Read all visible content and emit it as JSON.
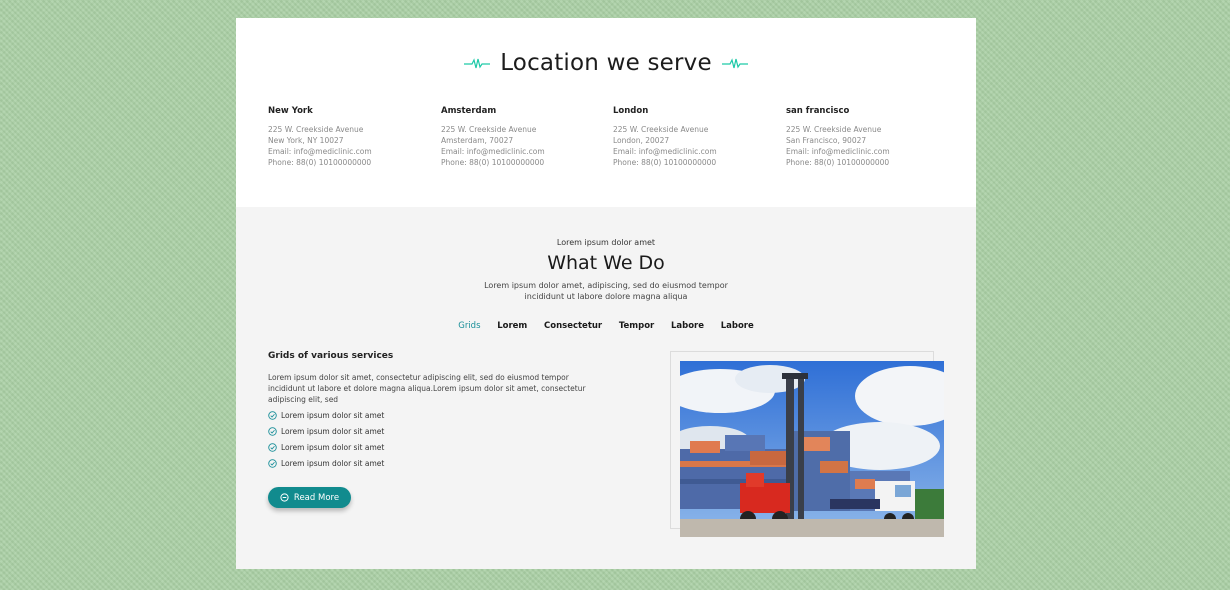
{
  "locations": {
    "title": "Location we serve",
    "accent_color": "#1ec9a8",
    "items": [
      {
        "city": "New York",
        "address": "225 W. Creekside Avenue",
        "city_line": "New York, NY 10027",
        "email": "Email: info@mediclinic.com",
        "phone": "Phone: 88(0) 10100000000"
      },
      {
        "city": "Amsterdam",
        "address": "225 W. Creekside Avenue",
        "city_line": "Amsterdam, 70027",
        "email": "Email: info@mediclinic.com",
        "phone": "Phone: 88(0) 10100000000"
      },
      {
        "city": "London",
        "address": "225 W. Creekside Avenue",
        "city_line": "London, 20027",
        "email": "Email: info@mediclinic.com",
        "phone": "Phone: 88(0) 10100000000"
      },
      {
        "city": "san francisco",
        "address": "225 W. Creekside Avenue",
        "city_line": "San Francisco, 90027",
        "email": "Email: info@mediclinic.com",
        "phone": "Phone: 88(0) 10100000000"
      }
    ]
  },
  "what_we_do": {
    "kicker": "Lorem ipsum dolor amet",
    "title": "What We Do",
    "description": "Lorem ipsum dolor amet, adipiscing, sed do eiusmod tempor incididunt ut labore dolore magna aliqua",
    "tabs": [
      "Grids",
      "Lorem",
      "Consectetur",
      "Tempor",
      "Labore",
      "Labore"
    ],
    "active_tab_color": "#1a8f99",
    "content_title": "Grids of various services",
    "content_text": "Lorem ipsum dolor sit amet, consectetur adipiscing elit, sed do eiusmod tempor incididunt ut labore et dolore magna aliqua.Lorem ipsum dolor sit amet, consectetur adipiscing elit, sed",
    "checklist": [
      "Lorem ipsum dolor sit amet",
      "Lorem ipsum dolor sit amet",
      "Lorem ipsum dolor sit amet",
      "Lorem ipsum dolor sit amet"
    ],
    "check_icon": "check-circle-icon",
    "button_label": "Read More",
    "button_icon": "minus-circle-icon",
    "button_color": "#118b8e"
  }
}
